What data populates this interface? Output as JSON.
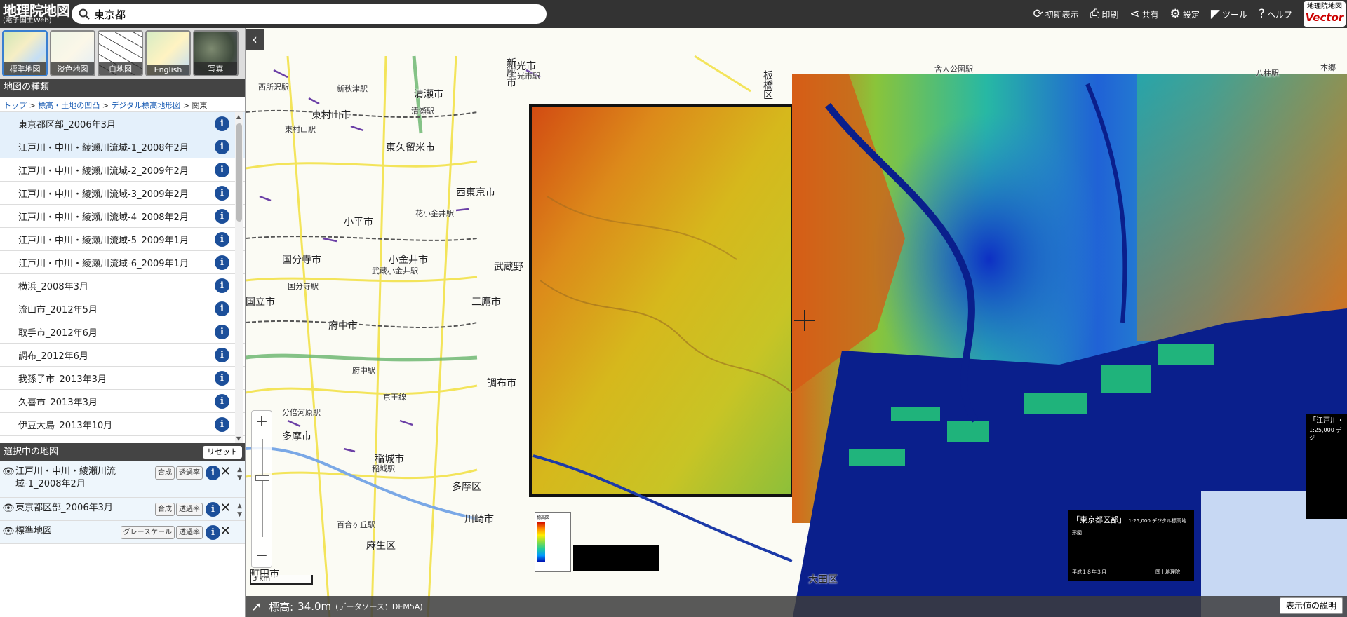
{
  "header": {
    "logo_title": "地理院地図",
    "logo_sub": "(電子国土Web)",
    "search_value": "東京都",
    "tools": [
      {
        "icon": "⟳",
        "label": "初期表示"
      },
      {
        "icon": "⎙",
        "label": "印刷"
      },
      {
        "icon": "⋖",
        "label": "共有"
      },
      {
        "icon": "⚙",
        "label": "設定"
      },
      {
        "icon": "◤",
        "label": "ツール"
      },
      {
        "icon": "?",
        "label": "ヘルプ"
      }
    ],
    "vector_logo_top": "地理院地図",
    "vector_logo_bottom": "Vector"
  },
  "basemaps": [
    {
      "label": "標準地図",
      "selected": true
    },
    {
      "label": "淡色地図",
      "selected": false
    },
    {
      "label": "白地図",
      "selected": false
    },
    {
      "label": "English",
      "selected": false
    },
    {
      "label": "写真",
      "selected": false
    }
  ],
  "map_types": {
    "title": "地図の種類",
    "breadcrumb": {
      "links": [
        "トップ",
        "標高・土地の凹凸",
        "デジタル標高地形図"
      ],
      "current": "関東",
      "sep": " > "
    },
    "layers": [
      {
        "label": "東京都区部_2006年3月",
        "selected": true
      },
      {
        "label": "江戸川・中川・綾瀬川流域-1_2008年2月",
        "selected": true
      },
      {
        "label": "江戸川・中川・綾瀬川流域-2_2009年2月",
        "selected": false
      },
      {
        "label": "江戸川・中川・綾瀬川流域-3_2009年2月",
        "selected": false
      },
      {
        "label": "江戸川・中川・綾瀬川流域-4_2008年2月",
        "selected": false
      },
      {
        "label": "江戸川・中川・綾瀬川流域-5_2009年1月",
        "selected": false
      },
      {
        "label": "江戸川・中川・綾瀬川流域-6_2009年1月",
        "selected": false
      },
      {
        "label": "横浜_2008年3月",
        "selected": false
      },
      {
        "label": "流山市_2012年5月",
        "selected": false
      },
      {
        "label": "取手市_2012年6月",
        "selected": false
      },
      {
        "label": "調布_2012年6月",
        "selected": false
      },
      {
        "label": "我孫子市_2013年3月",
        "selected": false
      },
      {
        "label": "久喜市_2013年3月",
        "selected": false
      },
      {
        "label": "伊豆大島_2013年10月",
        "selected": false
      }
    ]
  },
  "selected_maps": {
    "title": "選択中の地図",
    "reset_label": "リセット",
    "items": [
      {
        "label": "江戸川・中川・綾瀬川流域-1_2008年2月",
        "btn1": "合成",
        "btn2": "透過率"
      },
      {
        "label": "東京都区部_2006年3月",
        "btn1": "合成",
        "btn2": "透過率"
      },
      {
        "label": "標準地図",
        "btn1": "グレースケール",
        "btn2": "透過率"
      }
    ]
  },
  "map": {
    "labels": [
      "和光市",
      "和光市駅",
      "清瀬市",
      "新座市",
      "板橋区",
      "東村山市",
      "東久留米市",
      "西東京市",
      "小平市",
      "国分寺市",
      "小金井市",
      "武蔵野",
      "三鷹市",
      "国立市",
      "府中市",
      "調布市",
      "多摩市",
      "稲城市",
      "多摩区",
      "川崎市",
      "麻生区",
      "町田市",
      "大田区",
      "西所沢駅",
      "新秋津駅",
      "清瀬駅",
      "東村山駅",
      "花小金井駅",
      "武蔵小金井駅",
      "国分寺駅",
      "府中駅",
      "分倍河原駅",
      "京王線",
      "稲城駅",
      "百合ヶ丘駅",
      "舎人公園駅",
      "八柱駅",
      "本郷"
    ],
    "scale_label": "3 km",
    "elevation_label": "標高:",
    "elevation_value": "34.0m",
    "data_source": "(データソース：DEM5A)",
    "explain_button": "表示値の説明",
    "legend_small_title": "標高図",
    "tokyo_legend_title": "「東京都区部」",
    "tokyo_legend_sub": "1:25,000 デジタル標高地形図",
    "tokyo_legend_date": "平成１８年３月",
    "tokyo_legend_org": "国土地理院",
    "edogawa_legend_title": "「江戸川・",
    "edogawa_legend_sub": "1:25,000 デジ"
  },
  "colors": {
    "header_bg": "#333333",
    "accent": "#1c4f9a",
    "water_dark": "#0a1f8c"
  }
}
